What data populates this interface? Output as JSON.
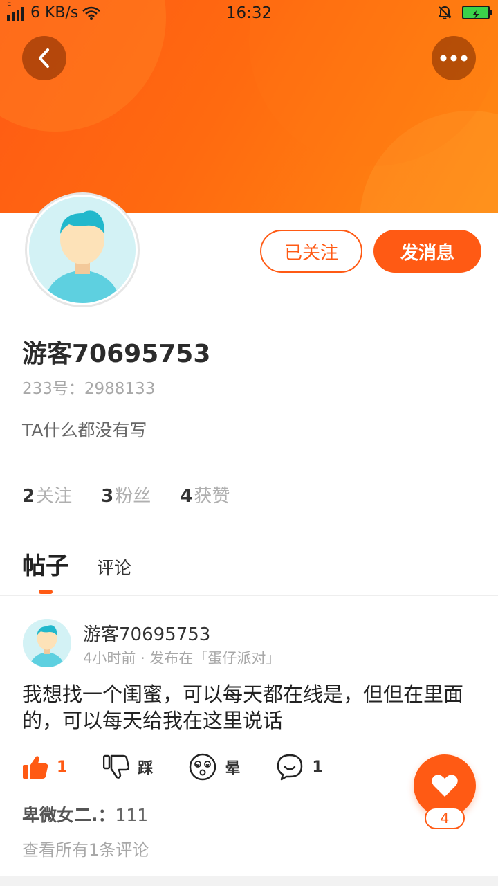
{
  "status_bar": {
    "network_speed": "6 KB/s",
    "time": "16:32",
    "network_label": "E"
  },
  "header": {
    "back_icon": "chevron-left-icon",
    "more_icon": "more-dots-icon"
  },
  "profile": {
    "username": "游客70695753",
    "id_label": "233号：2988133",
    "bio": "TA什么都没有写",
    "follow_button": "已关注",
    "message_button": "发消息",
    "stats": [
      {
        "count": "2",
        "label": "关注"
      },
      {
        "count": "3",
        "label": "粉丝"
      },
      {
        "count": "4",
        "label": "获赞"
      }
    ]
  },
  "tabs": {
    "posts": "帖子",
    "comments": "评论"
  },
  "post": {
    "author": "游客70695753",
    "meta": "4小时前 · 发布在「蛋仔派对」",
    "body": "我想找一个闺蜜，可以每天都在线是，但但在里面的，可以每天给我在这里说话",
    "actions": {
      "like_count": "1",
      "dislike_label": "踩",
      "dizzy_label": "晕",
      "comment_count": "1"
    },
    "comment_preview": {
      "name": "卑微女二.：",
      "text": "111"
    },
    "view_all": "查看所有1条评论"
  },
  "fab": {
    "count": "4"
  },
  "colors": {
    "accent": "#ff5a14",
    "banner_start": "#ff5a14",
    "banner_end": "#ff8a12"
  }
}
